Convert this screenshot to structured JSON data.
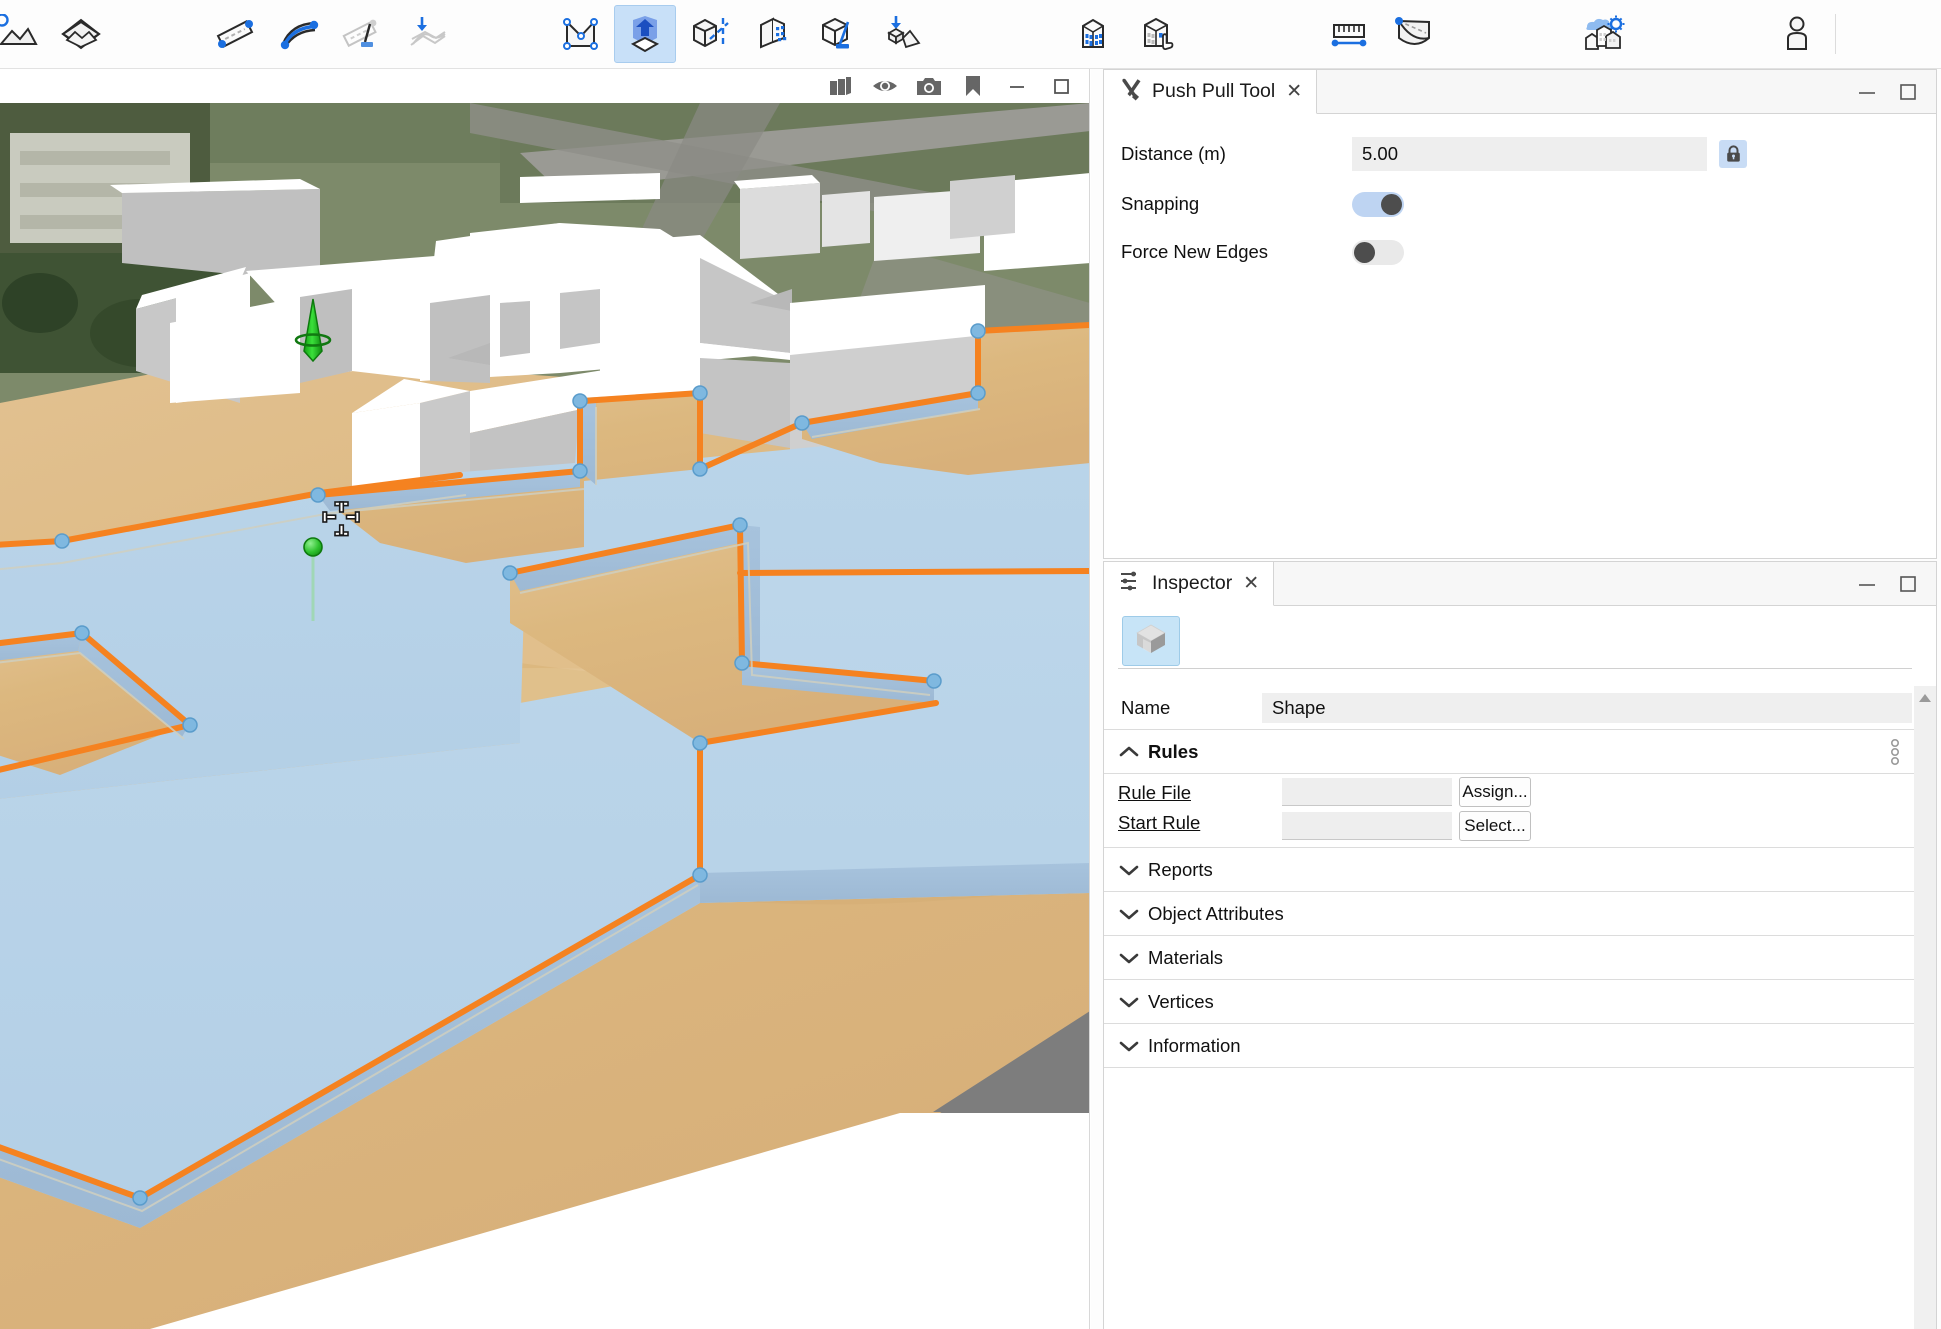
{
  "toolbar": {
    "groups": [
      {
        "name": "scene-group",
        "buttons": [
          {
            "id": "terrain-layer",
            "icon": "terrain-layer-icon",
            "label": "Terrain Layer",
            "active": false
          },
          {
            "id": "scene-layer",
            "icon": "scene-layer-icon",
            "label": "Scene Layer",
            "active": false
          }
        ]
      },
      {
        "name": "street-group",
        "buttons": [
          {
            "id": "street-create",
            "icon": "street-create-icon",
            "label": "Street Creation",
            "active": false
          },
          {
            "id": "street-curve",
            "icon": "street-curve-icon",
            "label": "Curved Street",
            "active": false
          },
          {
            "id": "street-cleanup",
            "icon": "street-cleanup-icon",
            "label": "Street Cleanup",
            "active": false
          },
          {
            "id": "street-align",
            "icon": "street-align-icon",
            "label": "Align Streets to Terrain",
            "active": false
          }
        ]
      },
      {
        "name": "shape-group",
        "buttons": [
          {
            "id": "polygonal-shape",
            "icon": "polygonal-shape-icon",
            "label": "Polygonal Shape Creation",
            "active": false
          },
          {
            "id": "push-pull",
            "icon": "push-pull-icon",
            "label": "Push Pull Tool",
            "active": true
          },
          {
            "id": "mirror",
            "icon": "mirror-icon",
            "label": "Mirror Tool",
            "active": false
          },
          {
            "id": "scatter",
            "icon": "scatter-icon",
            "label": "Scatter Tool",
            "active": false
          },
          {
            "id": "face-tool",
            "icon": "face-tool-icon",
            "label": "Face Tool",
            "active": false
          },
          {
            "id": "align-shapes-terrain",
            "icon": "align-shapes-terrain-icon",
            "label": "Align Shapes to Terrain",
            "active": false
          }
        ]
      },
      {
        "name": "model-group",
        "buttons": [
          {
            "id": "generate-models",
            "icon": "building-icon",
            "label": "Generate Models",
            "active": false
          },
          {
            "id": "select-models",
            "icon": "building-select-icon",
            "label": "Select Models",
            "active": false
          }
        ]
      },
      {
        "name": "measure-group",
        "buttons": [
          {
            "id": "measure",
            "icon": "ruler-icon",
            "label": "Measure",
            "active": false
          },
          {
            "id": "viewshed",
            "icon": "viewshed-icon",
            "label": "Viewshed",
            "active": false
          }
        ]
      },
      {
        "name": "analysis-group",
        "buttons": [
          {
            "id": "sun-analysis",
            "icon": "city-sun-icon",
            "label": "Sun / Shadow Analysis",
            "active": false
          }
        ]
      },
      {
        "name": "user-group",
        "buttons": [
          {
            "id": "person",
            "icon": "person-icon",
            "label": "Person View",
            "active": false
          }
        ]
      }
    ]
  },
  "viewport": {
    "overlay_buttons": [
      {
        "id": "layers",
        "icon": "layers-icon",
        "label": "Layers"
      },
      {
        "id": "visibility",
        "icon": "eye-icon",
        "label": "Visibility"
      },
      {
        "id": "snapshot",
        "icon": "camera-icon",
        "label": "Snapshot"
      },
      {
        "id": "bookmark",
        "icon": "bookmark-icon",
        "label": "Bookmarks"
      },
      {
        "id": "minimize",
        "icon": "minimize-icon",
        "label": "Minimize"
      },
      {
        "id": "maximize",
        "icon": "maximize-icon",
        "label": "Maximize"
      }
    ],
    "colors": {
      "terrain": "#ddb77f",
      "selection_fill": "#b6d1e8",
      "selection_edge": "#f58220",
      "vertex": "#7fb8e0",
      "gizmo_axis": "#22c022",
      "building_white": "#ffffff",
      "building_shade": "#9b9b9b",
      "ground_shadow": "#7d7d7d"
    },
    "gizmo": {
      "axis": "z-up",
      "handles": [
        "cone-arrow",
        "ring",
        "sphere",
        "snap-handle-top",
        "snap-handle-left",
        "snap-handle-right",
        "snap-handle-bottom"
      ]
    }
  },
  "push_pull_panel": {
    "tab_title": "Push Pull Tool",
    "tab_icon": "tools-icon",
    "close_label": "✕",
    "minimize_label": "—",
    "maximize_label": "□",
    "rows": [
      {
        "id": "distance",
        "label": "Distance (m)",
        "type": "text",
        "value": "5.00",
        "lock_icon": "lock-icon",
        "locked": true
      },
      {
        "id": "snapping",
        "label": "Snapping",
        "type": "toggle",
        "value": "on"
      },
      {
        "id": "force-new-edges",
        "label": "Force New Edges",
        "type": "toggle",
        "value": "off"
      }
    ]
  },
  "inspector_panel": {
    "tab_title": "Inspector",
    "tab_icon": "sliders-icon",
    "close_label": "✕",
    "minimize_label": "—",
    "maximize_label": "□",
    "object_icon": "cube-icon",
    "name_row": {
      "label": "Name",
      "value": "Shape"
    },
    "rules": {
      "label": "Rules",
      "expanded": true,
      "menu_icon": "vertical-dots-icon",
      "rule_file": {
        "label": "Rule File",
        "value": "",
        "button": "Assign..."
      },
      "start_rule": {
        "label": "Start Rule",
        "value": "",
        "button": "Select..."
      }
    },
    "sections": [
      {
        "id": "reports",
        "label": "Reports",
        "expanded": false
      },
      {
        "id": "object-attributes",
        "label": "Object Attributes",
        "expanded": false
      },
      {
        "id": "materials",
        "label": "Materials",
        "expanded": false
      },
      {
        "id": "vertices",
        "label": "Vertices",
        "expanded": false
      },
      {
        "id": "information",
        "label": "Information",
        "expanded": false
      }
    ],
    "scroll_arrow_icon": "triangle-up-icon"
  }
}
